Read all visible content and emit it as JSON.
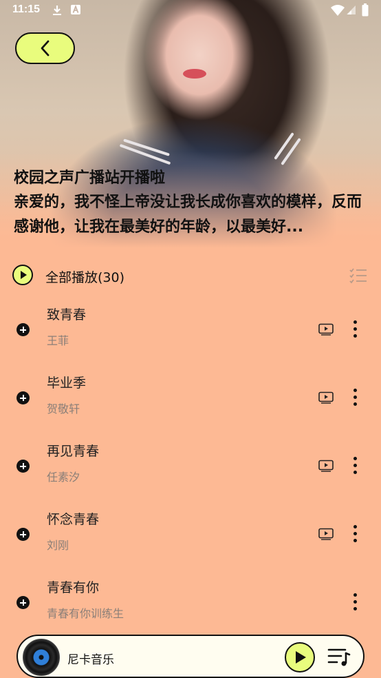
{
  "status_bar": {
    "time": "11:15",
    "icons": [
      "download-icon",
      "a-icon",
      "wifi-icon",
      "signal-icon",
      "battery-icon"
    ]
  },
  "header": {
    "back_icon": "chevron-left-icon"
  },
  "playlist": {
    "title": "校园之声广播站开播啦",
    "description": "亲爱的，我不怪上帝没让我长成你喜欢的模样，反而感谢他，让我在最美好的年龄，以最美好..."
  },
  "play_all": {
    "label": "全部播放(30)"
  },
  "songs": [
    {
      "name": "致青春",
      "artist": "王菲",
      "has_mv": true
    },
    {
      "name": "毕业季",
      "artist": "贺敬轩",
      "has_mv": true
    },
    {
      "name": "再见青春",
      "artist": "任素汐",
      "has_mv": true
    },
    {
      "name": "怀念青春",
      "artist": "刘刚",
      "has_mv": true
    },
    {
      "name": "青春有你",
      "artist": "青春有你训练生",
      "has_mv": false
    }
  ],
  "player": {
    "track": "尼卡音乐"
  },
  "colors": {
    "background": "#FDB994",
    "accent": "#E9FC7D",
    "text": "#111111",
    "subtext": "#8A7F78"
  }
}
